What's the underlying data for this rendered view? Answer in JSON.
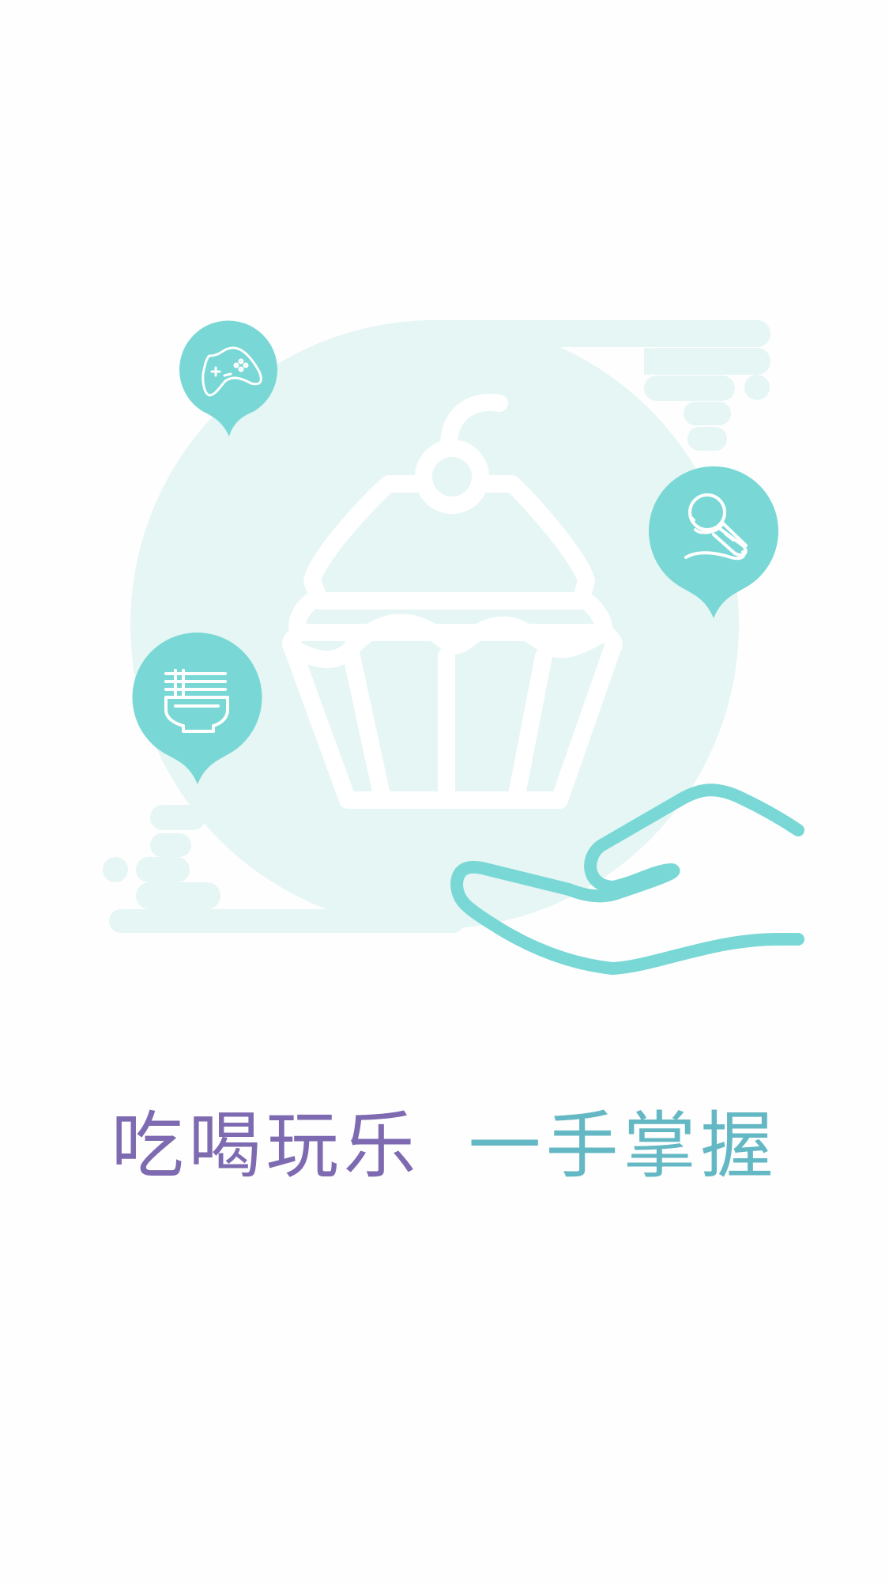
{
  "colors": {
    "background": "#fefefe",
    "circle_bg": "#e5f6f4",
    "accent_teal": "#79d8d6",
    "tagline_start": "#7d6ab0",
    "tagline_end": "#5fc4cc"
  },
  "illustration": {
    "main_icon": "cupcake-icon",
    "pins": [
      {
        "icon": "gamepad-icon"
      },
      {
        "icon": "microphone-icon"
      },
      {
        "icon": "noodle-bowl-icon"
      }
    ],
    "hand_icon": "hand-icon"
  },
  "tagline": {
    "part_a": "吃喝玩乐",
    "part_b": "一手掌握"
  }
}
